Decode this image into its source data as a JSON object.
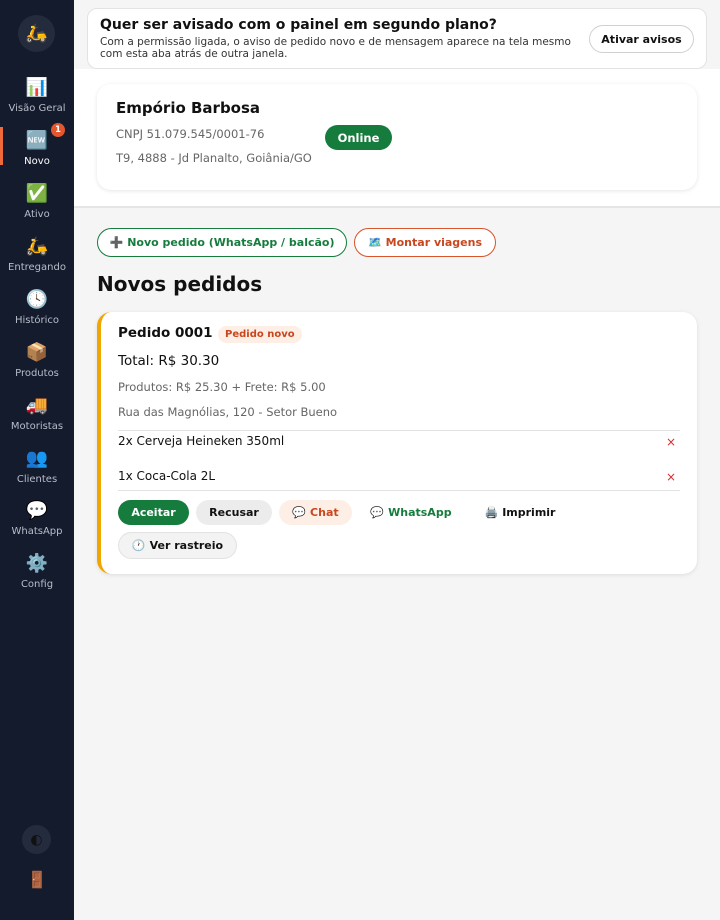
{
  "sidebar": {
    "logo_icon": "scooter-icon",
    "items": [
      {
        "label": "Visão Geral",
        "icon": "📊"
      },
      {
        "label": "Novo",
        "icon": "🆕",
        "badge": "1"
      },
      {
        "label": "Ativo",
        "icon": "✅"
      },
      {
        "label": "Entregando",
        "icon": "🛵"
      },
      {
        "label": "Histórico",
        "icon": "🕓"
      },
      {
        "label": "Produtos",
        "icon": "📦"
      },
      {
        "label": "Motoristas",
        "icon": "🚚"
      },
      {
        "label": "Clientes",
        "icon": "👥"
      },
      {
        "label": "WhatsApp",
        "icon": "💬"
      },
      {
        "label": "Config",
        "icon": "⚙️"
      }
    ],
    "active_item": "Novo"
  },
  "notification": {
    "title": "Quer ser avisado com o painel em segundo plano?",
    "text": "Com a permissão ligada, o aviso de pedido novo e de mensagem aparece na tela mesmo com esta aba atrás de outra janela.",
    "button": "Ativar avisos"
  },
  "store": {
    "name": "Empório Barbosa",
    "cnpj": "CNPJ 51.079.545/0001-76",
    "address": "T9, 4888 - Jd Planalto, Goiânia/GO",
    "status": "Online"
  },
  "actions": {
    "new_order": "Novo pedido (WhatsApp / balcão)",
    "trips": "Montar viagens"
  },
  "section_title": "Novos pedidos",
  "order": {
    "id": "Pedido 0001",
    "status": "Pedido novo",
    "total": "Total: R$ 30.30",
    "breakdown": "Produtos: R$ 25.30 + Frete: R$ 5.00",
    "address": "Rua das Magnólias, 120 - Setor Bueno",
    "items": [
      {
        "text": "2x Cerveja Heineken 350ml",
        "remove": "×"
      },
      {
        "text": "1x Coca-Cola 2L",
        "remove": "×"
      }
    ],
    "buttons": {
      "accept": "Aceitar",
      "refuse": "Recusar",
      "chat": "Chat",
      "whatsapp": "WhatsApp",
      "print": "Imprimir",
      "track": "Ver rastreio"
    }
  },
  "colors": {
    "sidebar_bg": "#141b2d",
    "primary_green": "#167c3d",
    "accent_orange": "#d9532b",
    "order_border": "#f0a500"
  }
}
